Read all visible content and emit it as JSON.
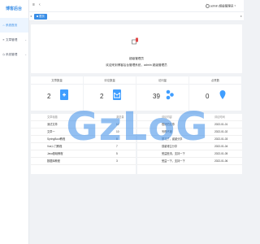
{
  "app": {
    "logo": "博客后台"
  },
  "sidebar": {
    "items": [
      {
        "icon": "⌂",
        "label": "系统首页"
      },
      {
        "icon": "≡",
        "label": "文章管理"
      },
      {
        "icon": "◷",
        "label": "系统管理"
      }
    ]
  },
  "header": {
    "user_label": "admin 超级管理员"
  },
  "tabs": [
    {
      "label": "首页"
    }
  ],
  "welcome": {
    "role": "超级管理员",
    "message": "欢迎来到博客后台管理系统，admin 超级管理员"
  },
  "stats": [
    {
      "title": "文章数量",
      "value": "2"
    },
    {
      "title": "评论数量",
      "value": "2"
    },
    {
      "title": "访问量",
      "value": "39"
    },
    {
      "title": "点赞数",
      "value": "0"
    }
  ],
  "colors": {
    "accent": "#3a8ee6",
    "primary_icon": "#409eff",
    "watermark": "#3b8ce8"
  },
  "tables": {
    "left": {
      "headers": [
        "文章标题",
        "浏览量"
      ],
      "rows": [
        [
          "测试文章",
          "12"
        ],
        [
          "文章一",
          "10"
        ],
        [
          "SpringBoot教程",
          "8"
        ],
        [
          "Vue入门教程",
          "7"
        ],
        [
          "Java基础教程",
          "5"
        ],
        [
          "数据库教程",
          "3"
        ]
      ]
    },
    "right": {
      "headers": [
        "评论内容",
        "评论时间"
      ],
      "rows": [
        [
          "很好的文章",
          "2022-01-01"
        ],
        [
          "写得不错",
          "2022-01-02"
        ],
        [
          "学习了，谢谢分享",
          "2022-01-03"
        ],
        [
          "感谢博主分享",
          "2022-01-04"
        ],
        [
          "受益匪浅，支持一下",
          "2022-01-05"
        ],
        [
          "受益一下，支持一下",
          "2022-01-06"
        ]
      ]
    }
  },
  "watermark": {
    "text": "GzLoG"
  }
}
